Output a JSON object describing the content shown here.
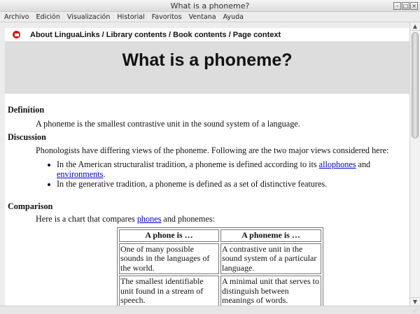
{
  "window": {
    "title": "What is a phoneme?"
  },
  "menubar": [
    "Archivo",
    "Edición",
    "Visualización",
    "Historial",
    "Favoritos",
    "Ventana",
    "Ayuda"
  ],
  "nav": {
    "links": [
      "About LinguaLinks",
      "Library contents",
      "Book contents",
      "Page context"
    ],
    "separator": " / "
  },
  "page": {
    "title": "What is a phoneme?",
    "definition": {
      "heading": "Definition",
      "text": "A phoneme is the smallest contrastive unit in the sound system of a language."
    },
    "discussion": {
      "heading": "Discussion",
      "intro": "Phonologists have differing views of the phoneme. Following are the two major views considered here:",
      "bullet1": {
        "pre": "In the American structuralist tradition, a phoneme is defined according to its ",
        "link1": "allophones",
        "mid": " and",
        "link2": "environments",
        "post": "."
      },
      "bullet2": "In the generative tradition, a phoneme is defined as a set of distinctive features."
    },
    "comparison": {
      "heading": "Comparison",
      "intro_pre": "Here is a chart that compares ",
      "intro_link": "phones",
      "intro_post": " and phonemes:",
      "table": {
        "headers": [
          "A phone is …",
          "A phoneme is …"
        ],
        "rows": [
          [
            "One of many possible sounds in the languages of the world.",
            "A contrastive unit in the sound system of a particular language."
          ],
          [
            "The smallest identifiable unit found in a stream of speech.",
            "A minimal unit that serves to distinguish between meanings of words."
          ]
        ]
      }
    }
  }
}
